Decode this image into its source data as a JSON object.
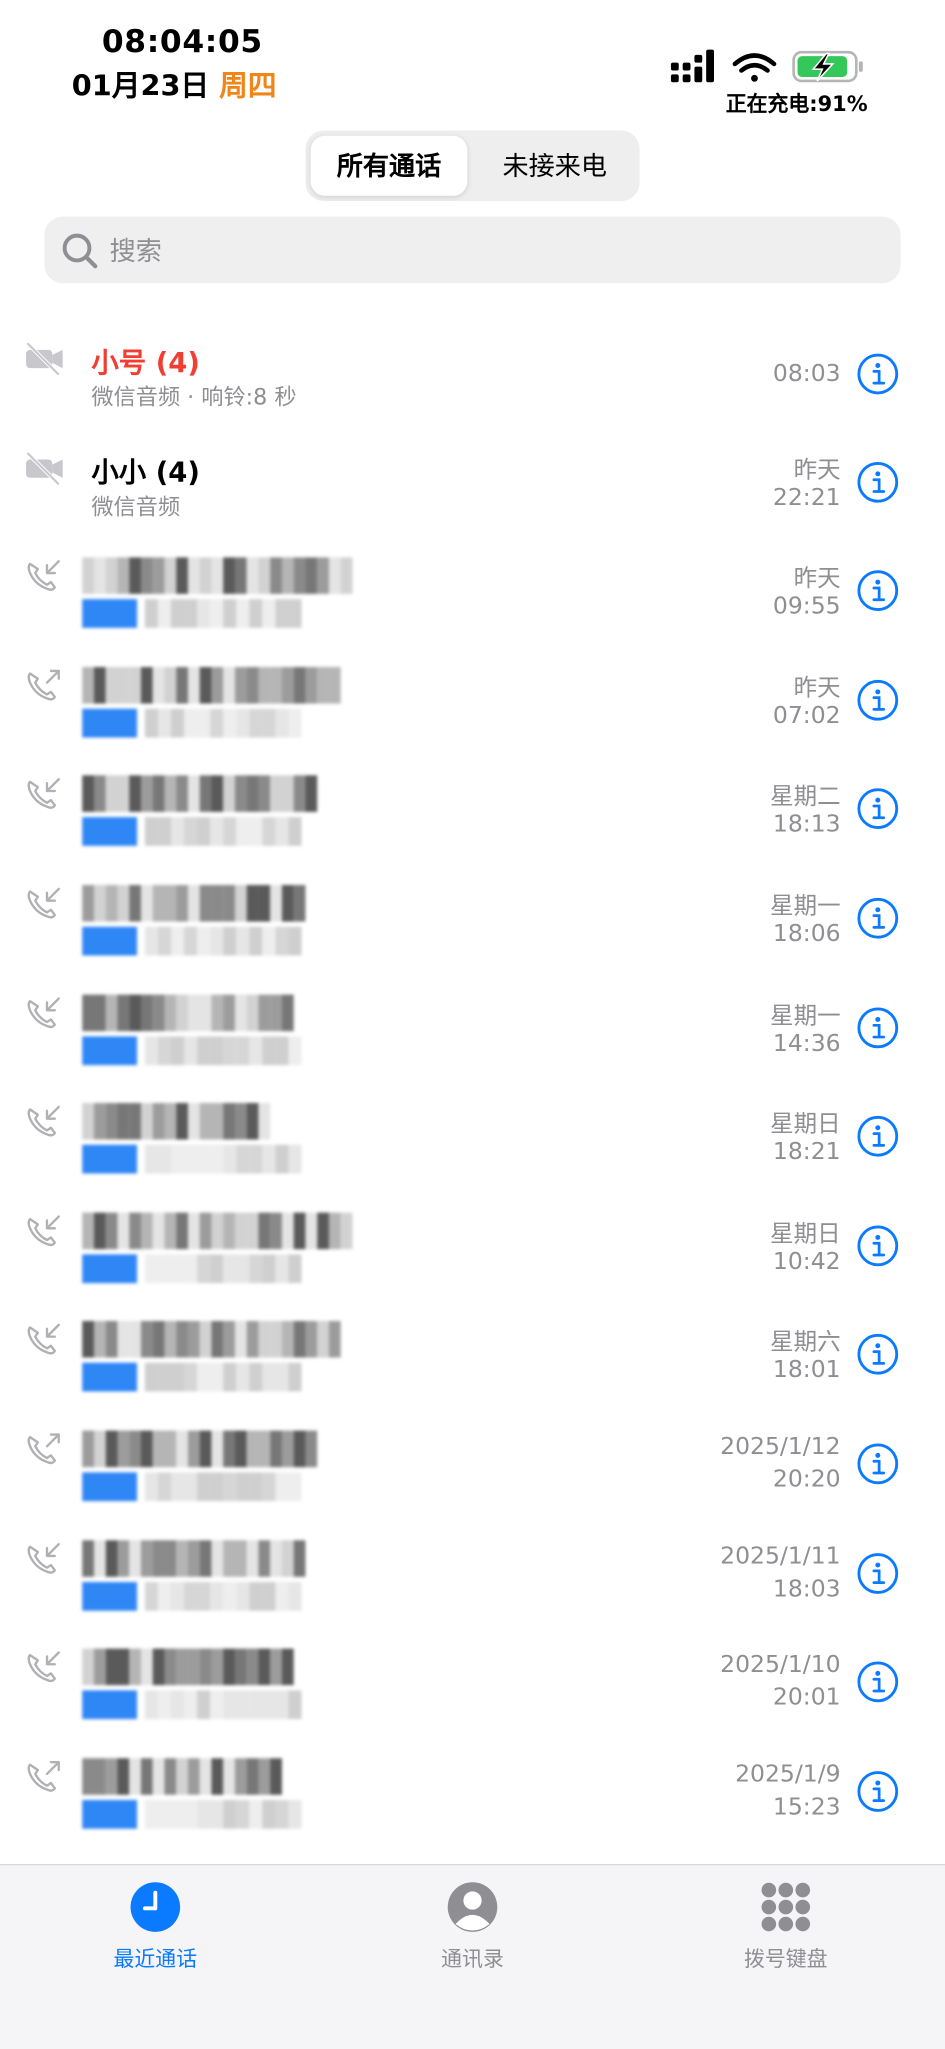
{
  "status_bar": {
    "time": "08:04:05",
    "date": "01月23日",
    "weekday": "周四",
    "charging_text": "正在充电:91%",
    "battery_percent": 91,
    "battery_color": "#34c759"
  },
  "segment": {
    "all_calls": "所有通话",
    "missed_calls": "未接来电",
    "selected": "所有通话"
  },
  "search": {
    "placeholder": "搜索"
  },
  "accent_color": "#0a7aff",
  "missed_color": "#f23d33",
  "calls": [
    {
      "name": "小号 (4)",
      "subtitle": "微信音频 · 响铃:8 秒",
      "time_line1": "08:03",
      "time_line2": "",
      "icon": "video-off-icon",
      "missed": true,
      "redacted": false
    },
    {
      "name": "小小 (4)",
      "subtitle": "微信音频",
      "time_line1": "昨天",
      "time_line2": "22:21",
      "icon": "video-off-icon",
      "missed": false,
      "redacted": false
    },
    {
      "time_line1": "昨天",
      "time_line2": "09:55",
      "icon": "incoming-call-icon",
      "redacted": true
    },
    {
      "time_line1": "昨天",
      "time_line2": "07:02",
      "icon": "outgoing-call-icon",
      "redacted": true
    },
    {
      "time_line1": "星期二",
      "time_line2": "18:13",
      "icon": "incoming-call-icon",
      "redacted": true
    },
    {
      "time_line1": "星期一",
      "time_line2": "18:06",
      "icon": "incoming-call-icon",
      "redacted": true
    },
    {
      "time_line1": "星期一",
      "time_line2": "14:36",
      "icon": "incoming-call-icon",
      "redacted": true
    },
    {
      "time_line1": "星期日",
      "time_line2": "18:21",
      "icon": "incoming-call-icon",
      "redacted": true
    },
    {
      "time_line1": "星期日",
      "time_line2": "10:42",
      "icon": "incoming-call-icon",
      "redacted": true
    },
    {
      "time_line1": "星期六",
      "time_line2": "18:01",
      "icon": "incoming-call-icon",
      "redacted": true
    },
    {
      "time_line1": "2025/1/12",
      "time_line2": "20:20",
      "icon": "outgoing-call-icon",
      "redacted": true
    },
    {
      "time_line1": "2025/1/11",
      "time_line2": "18:03",
      "icon": "incoming-call-icon",
      "redacted": true
    },
    {
      "time_line1": "2025/1/10",
      "time_line2": "20:01",
      "icon": "incoming-call-icon",
      "redacted": true
    },
    {
      "time_line1": "2025/1/9",
      "time_line2": "15:23",
      "icon": "outgoing-call-icon",
      "redacted": true
    }
  ],
  "tab_bar": {
    "recents": "最近通话",
    "contacts": "通讯录",
    "keypad": "拨号键盘",
    "selected": "最近通话"
  }
}
